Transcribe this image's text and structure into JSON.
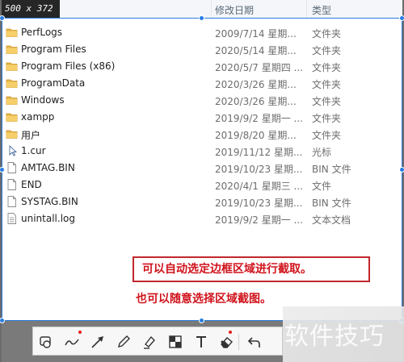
{
  "selection": {
    "size_label": "500 x 372"
  },
  "columns": {
    "date": "修改日期",
    "type": "类型"
  },
  "files": [
    {
      "icon": "folder-icon",
      "name": "PerfLogs",
      "date": "2009/7/14 星期...",
      "type": "文件夹"
    },
    {
      "icon": "folder-icon",
      "name": "Program Files",
      "date": "2020/5/14 星期...",
      "type": "文件夹"
    },
    {
      "icon": "folder-icon",
      "name": "Program Files (x86)",
      "date": "2020/5/7 星期四 ...",
      "type": "文件夹"
    },
    {
      "icon": "folder-icon",
      "name": "ProgramData",
      "date": "2020/3/26 星期...",
      "type": "文件夹"
    },
    {
      "icon": "folder-icon",
      "name": "Windows",
      "date": "2020/3/26 星期...",
      "type": "文件夹"
    },
    {
      "icon": "folder-icon",
      "name": "xampp",
      "date": "2019/9/2 星期一 ...",
      "type": "文件夹"
    },
    {
      "icon": "folder-icon",
      "name": "用户",
      "date": "2019/8/20 星期...",
      "type": "文件夹"
    },
    {
      "icon": "cursor-file-icon",
      "name": "1.cur",
      "date": "2019/11/12 星期...",
      "type": "光标"
    },
    {
      "icon": "file-icon",
      "name": "AMTAG.BIN",
      "date": "2019/10/23 星期...",
      "type": "BIN 文件"
    },
    {
      "icon": "file-icon",
      "name": "END",
      "date": "2020/4/1 星期三 ...",
      "type": "文件"
    },
    {
      "icon": "file-icon",
      "name": "SYSTAG.BIN",
      "date": "2019/10/23 星期...",
      "type": "BIN 文件"
    },
    {
      "icon": "text-file-icon",
      "name": "unintall.log",
      "date": "2019/9/2 星期一 ...",
      "type": "文本文档"
    }
  ],
  "annotations": {
    "callout": "可以自动选定边框区域进行截取。",
    "caption": "也可以随意选择区域截图。"
  },
  "toolbar": {
    "tools": [
      "rectangle-tool-icon",
      "freehand-tool-icon",
      "arrow-tool-icon",
      "pen-tool-icon",
      "highlighter-tool-icon",
      "mosaic-tool-icon",
      "text-tool-icon",
      "number-marker-icon",
      "eraser-tool-icon",
      "undo-icon"
    ]
  },
  "watermark": "软件技巧",
  "colors": {
    "accent": "#2a7de1",
    "annotation_red": "#d0121b",
    "folder": "#e8b44a"
  }
}
